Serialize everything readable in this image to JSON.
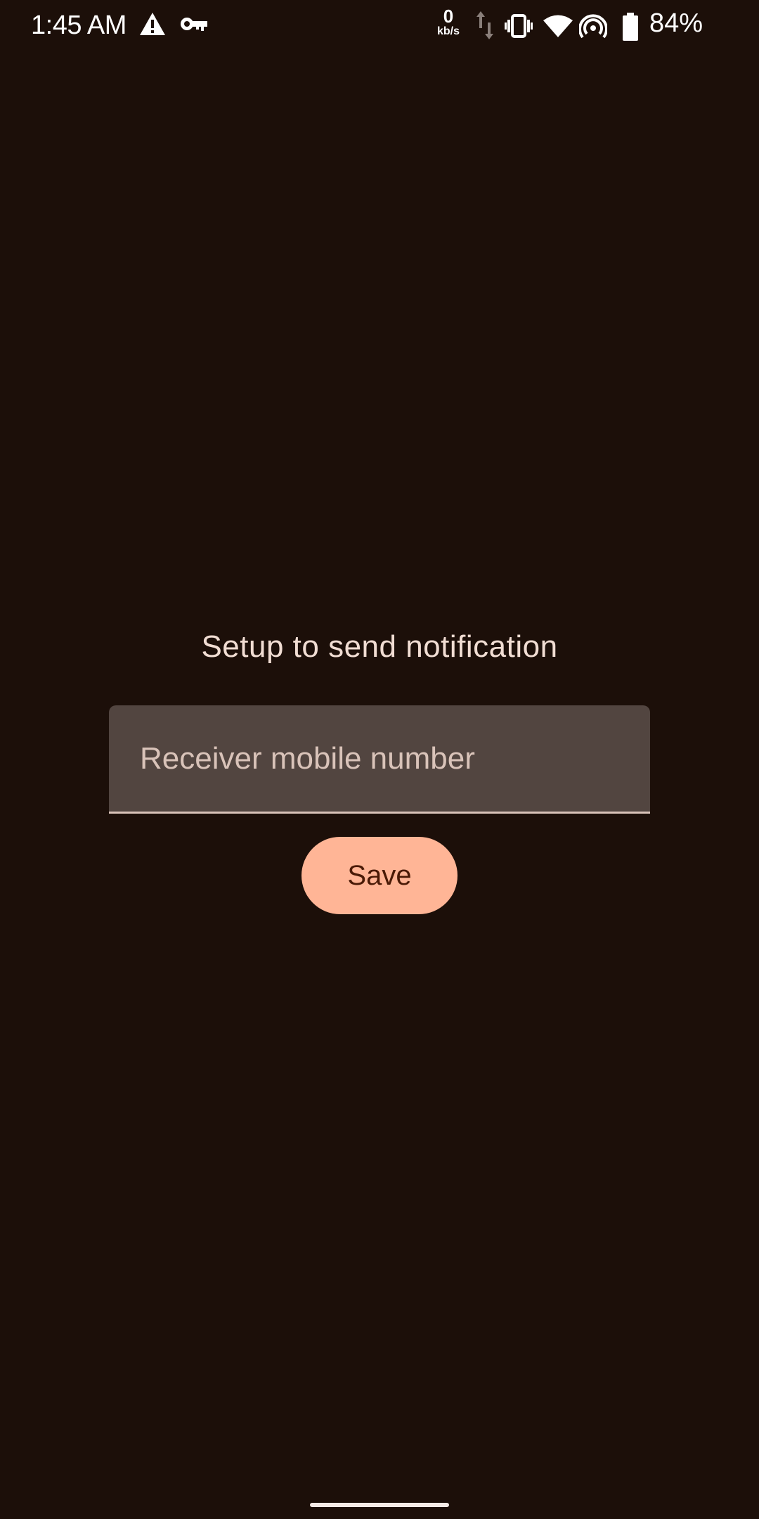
{
  "status_bar": {
    "time": "1:45 AM",
    "data_rate_value": "0",
    "data_rate_unit": "kb/s",
    "battery_percent": "84%",
    "icons": [
      "warning-icon",
      "vpn-key-icon",
      "data-arrows-icon",
      "vibrate-icon",
      "wifi-icon",
      "hotspot-icon",
      "battery-icon"
    ]
  },
  "main": {
    "title": "Setup to send notification",
    "phone_field": {
      "placeholder": "Receiver mobile number",
      "value": ""
    },
    "save_label": "Save"
  },
  "colors": {
    "background": "#1c0f09",
    "field_background": "#524540",
    "accent": "#ffb596",
    "on_accent": "#4a1a06",
    "text": "#f1ddd3"
  }
}
